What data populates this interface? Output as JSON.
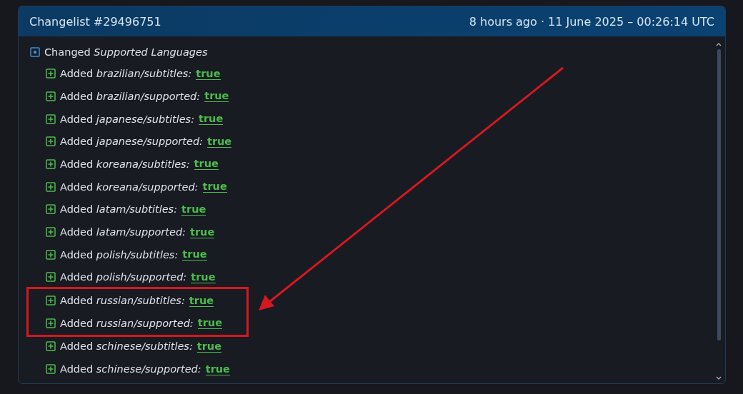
{
  "header": {
    "title": "Changelist #29496751",
    "time": "8 hours ago · 11 June 2025 – 00:26:14 UTC"
  },
  "root": {
    "kind": "changed",
    "text": "Changed *Supported Languages*",
    "children": [
      {
        "kind": "added",
        "text": "Added *brazilian/subtitles:*",
        "value": "true",
        "highlighted": false
      },
      {
        "kind": "added",
        "text": "Added *brazilian/supported:*",
        "value": "true",
        "highlighted": false
      },
      {
        "kind": "added",
        "text": "Added *japanese/subtitles:*",
        "value": "true",
        "highlighted": false
      },
      {
        "kind": "added",
        "text": "Added *japanese/supported:*",
        "value": "true",
        "highlighted": false
      },
      {
        "kind": "added",
        "text": "Added *koreana/subtitles:*",
        "value": "true",
        "highlighted": false
      },
      {
        "kind": "added",
        "text": "Added *koreana/supported:*",
        "value": "true",
        "highlighted": false
      },
      {
        "kind": "added",
        "text": "Added *latam/subtitles:*",
        "value": "true",
        "highlighted": false
      },
      {
        "kind": "added",
        "text": "Added *latam/supported:*",
        "value": "true",
        "highlighted": false
      },
      {
        "kind": "added",
        "text": "Added *polish/subtitles:*",
        "value": "true",
        "highlighted": false
      },
      {
        "kind": "added",
        "text": "Added *polish/supported:*",
        "value": "true",
        "highlighted": false
      },
      {
        "kind": "added",
        "text": "Added *russian/subtitles:*",
        "value": "true",
        "highlighted": true
      },
      {
        "kind": "added",
        "text": "Added *russian/supported:*",
        "value": "true",
        "highlighted": true
      },
      {
        "kind": "added",
        "text": "Added *schinese/subtitles:*",
        "value": "true",
        "highlighted": false
      },
      {
        "kind": "added",
        "text": "Added *schinese/supported:*",
        "value": "true",
        "highlighted": false
      }
    ]
  }
}
